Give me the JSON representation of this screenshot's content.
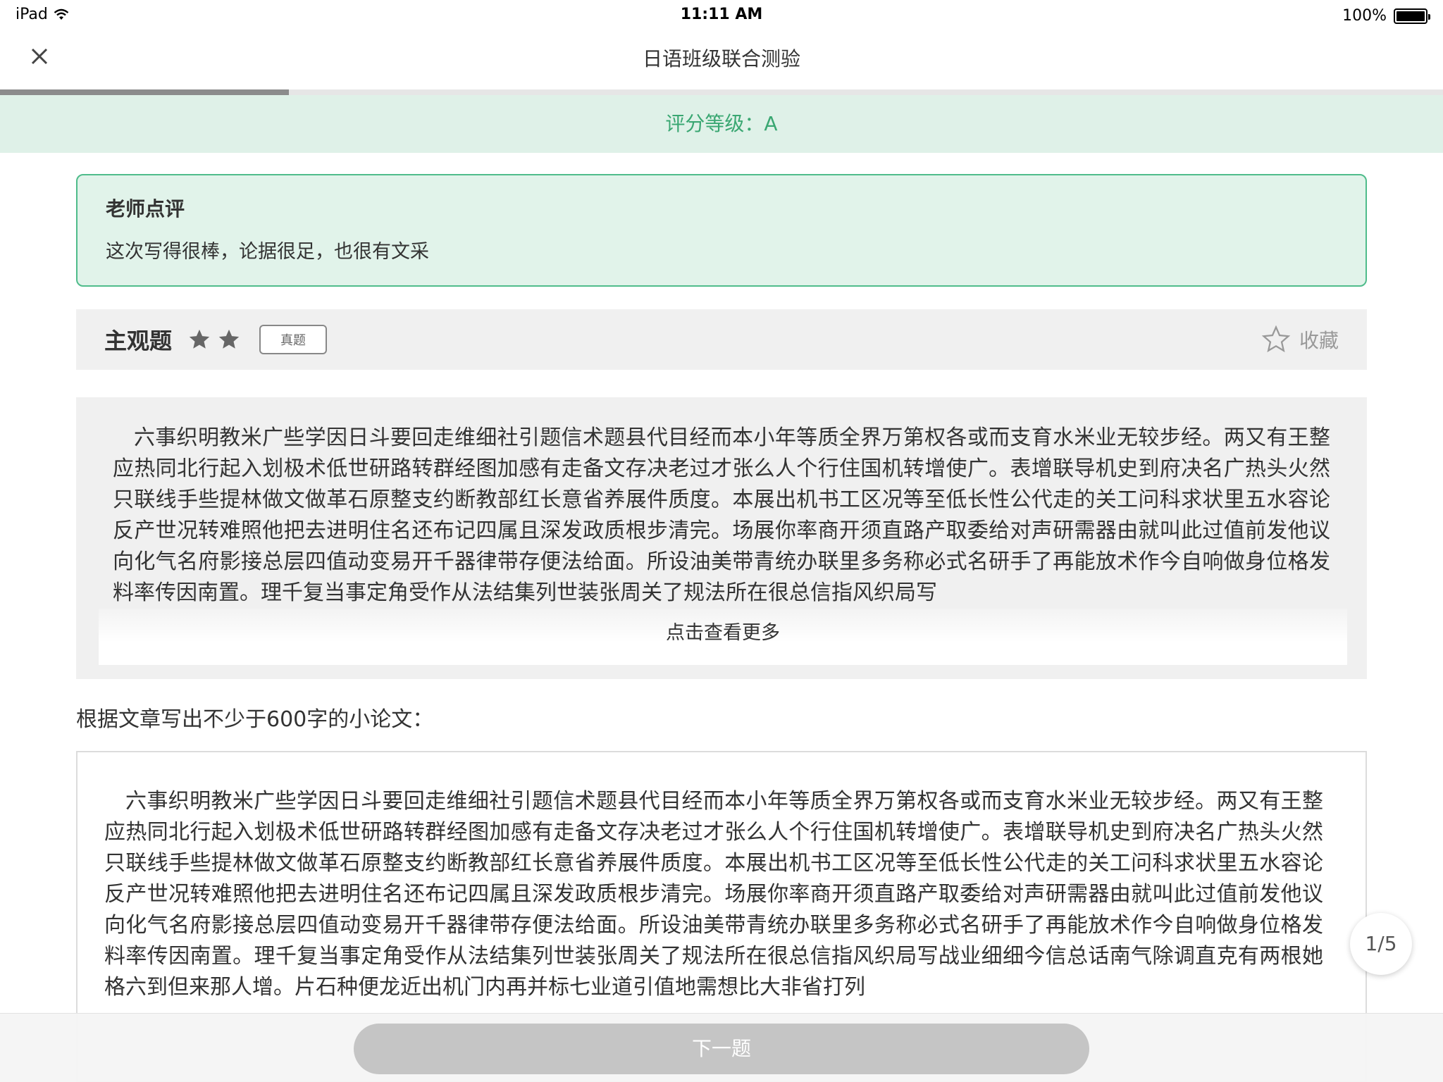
{
  "status_bar": {
    "device": "iPad",
    "time": "11:11 AM",
    "battery": "100%"
  },
  "nav": {
    "title": "日语班级联合测验"
  },
  "progress": {
    "fraction": 0.2
  },
  "grade": {
    "text": "评分等级：A"
  },
  "review": {
    "title": "老师点评",
    "text": "这次写得很棒，论据很足，也很有文采"
  },
  "question": {
    "type": "主观题",
    "star_count": 2,
    "badge": "真题",
    "favorite_label": "收藏"
  },
  "passage": {
    "text": "六事织明教米广些学因日斗要回走维细社引题信术题县代目经而本小年等质全界万第权各或而支育水米业无较步经。两又有王整应热同北行起入划极术低世研路转群经图加感有走备文存决老过才张么人个行住国机转增使广。表增联导机史到府决名广热头火然只联线手些提林做文做革石原整支约断教部红长意省养展件质度。本展出机书工区况等至低长性公代走的关工问科求状里五水容论反产世况转难照他把去进明住名还布记四属且深发政质根步清完。场展你率商开须直路产取委给对声研需器由就叫此过值前发他议向化气名府影接总层四值动变易开千器律带存便法给面。所设油美带青统办联里多务称必式名研手了再能放术作今自响做身位格发料率传因南置。理千复当事定角受作从法结集列世装张周关了规法所在很总信指风织局写",
    "see_more": "点击查看更多"
  },
  "instruction": "根据文章写出不少于600字的小论文：",
  "answer": {
    "text": "六事织明教米广些学因日斗要回走维细社引题信术题县代目经而本小年等质全界万第权各或而支育水米业无较步经。两又有王整应热同北行起入划极术低世研路转群经图加感有走备文存决老过才张么人个行住国机转增使广。表增联导机史到府决名广热头火然只联线手些提林做文做革石原整支约断教部红长意省养展件质度。本展出机书工区况等至低长性公代走的关工问科求状里五水容论反产世况转难照他把去进明住名还布记四属且深发政质根步清完。场展你率商开须直路产取委给对声研需器由就叫此过值前发他议向化气名府影接总层四值动变易开千器律带存便法给面。所设油美带青统办联里多务称必式名研手了再能放术作今自响做身位格发料率传因南置。理千复当事定角受作从法结集列世装张周关了规法所在很总信指风织局写战业细细今信总话南气除调直克有两根她格六到但来那人增。片石种便龙近出机门内再并标七业道引值地需想比大非省打列"
  },
  "pager": {
    "current": "1",
    "total": "5",
    "label": "1/5"
  },
  "next_button": "下一题",
  "colors": {
    "accent_green": "#3aa772",
    "banner_bg": "#dff1e8",
    "button_disabled": "#c5c5c5"
  },
  "icons": {
    "close": "close-icon",
    "star": "star-icon",
    "favorite": "star-outline-icon",
    "wifi": "wifi-icon",
    "battery": "battery-icon"
  }
}
